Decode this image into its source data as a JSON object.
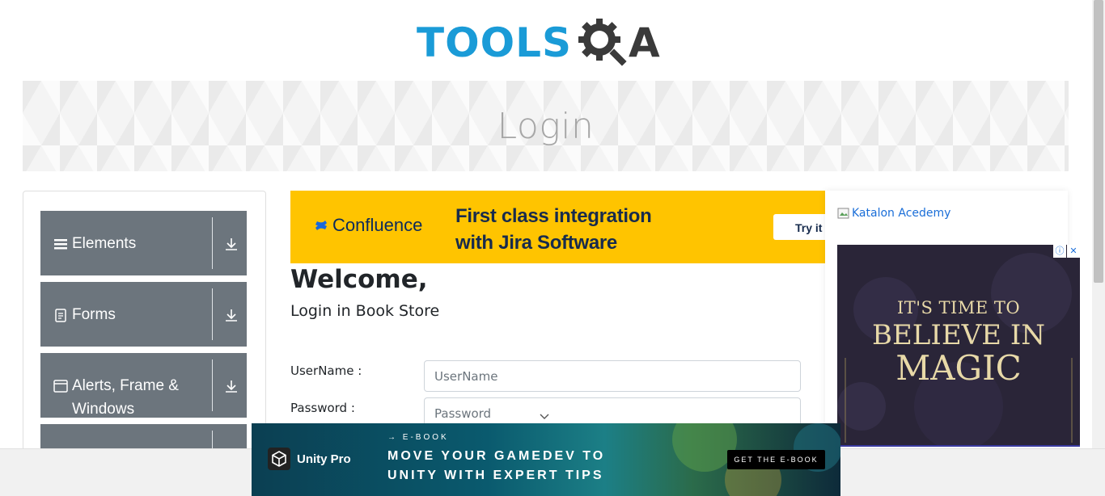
{
  "header": {
    "logo_tools": "TOOLS",
    "logo_a": "A",
    "logo_colors": {
      "primary": "#1a9bd7",
      "secondary": "#3a3a3a"
    }
  },
  "banner": {
    "title": "Login"
  },
  "sidebar": {
    "groups": [
      {
        "label": "Elements",
        "icon": "list-icon",
        "action_icon": "download-arrow-icon"
      },
      {
        "label": "Forms",
        "icon": "document-icon",
        "action_icon": "download-arrow-icon"
      },
      {
        "label": "Alerts, Frame & Windows",
        "icon": "window-icon",
        "action_icon": "download-arrow-icon"
      },
      {
        "label": "",
        "icon": "",
        "action_icon": ""
      }
    ],
    "group_color": "#6c757d"
  },
  "ads": {
    "confluence": {
      "brand": "Confluence",
      "line1": "First class integration",
      "line2": "with Jira Software",
      "cta": "Try it f",
      "background": "#ffc400"
    },
    "katalon": {
      "alt_text": "Katalon Acedemy"
    },
    "magic": {
      "line1": "IT'S TIME TO",
      "line2": "BELIEVE IN",
      "line3": "MAGIC",
      "info_icon": "info-icon",
      "close_icon": "close-icon"
    },
    "unity": {
      "brand": "Unity Pro",
      "kicker": "→ E-BOOK",
      "headline1": "MOVE YOUR GAMEDEV TO",
      "headline2": "UNITY WITH EXPERT TIPS",
      "cta": "GET THE E-BOOK"
    }
  },
  "main": {
    "welcome": "Welcome,",
    "subtitle": "Login in Book Store",
    "username_label": "UserName :",
    "username_placeholder": "UserName",
    "password_label": "Password :",
    "password_placeholder": "Password"
  }
}
